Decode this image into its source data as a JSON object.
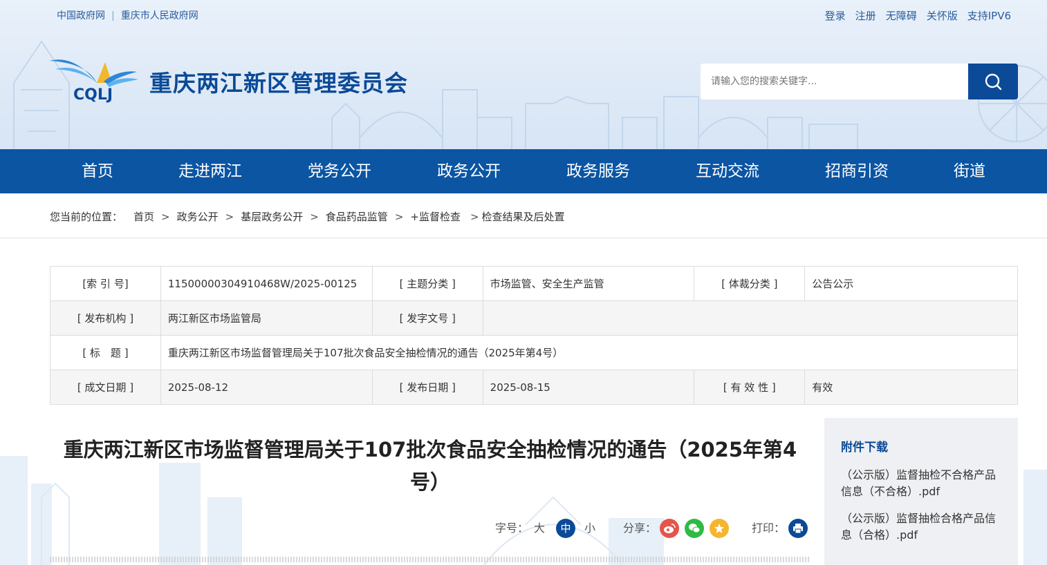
{
  "topbar": {
    "left_links": [
      "中国政府网",
      "重庆市人民政府网"
    ],
    "right_links": [
      "登录",
      "注册",
      "无障碍",
      "关怀版",
      "支持IPV6"
    ]
  },
  "header": {
    "logo_text": "CQLJ",
    "site_title": "重庆两江新区管理委员会",
    "search_placeholder": "请输入您的搜索关键字..."
  },
  "nav": [
    "首页",
    "走进两江",
    "党务公开",
    "政务公开",
    "政务服务",
    "互动交流",
    "招商引资",
    "街道"
  ],
  "breadcrumb": {
    "prefix": "您当前的位置：",
    "items": [
      "首页",
      "政务公开",
      "基层政务公开",
      "食品药品监管",
      "+监督检查",
      "检查结果及后处置"
    ]
  },
  "info": {
    "index_label": "[索 引 号]",
    "index_value": "11500000304910468W/2025-00125",
    "topic_label": "[ 主题分类 ]",
    "topic_value": "市场监管、安全生产监管",
    "genre_label": "[ 体裁分类 ]",
    "genre_value": "公告公示",
    "org_label": "[ 发布机构 ]",
    "org_value": "两江新区市场监管局",
    "docno_label": "[ 发字文号 ]",
    "docno_value": "",
    "title_label": "[ 标　题 ]",
    "title_value": "重庆两江新区市场监督管理局关于107批次食品安全抽检情况的通告（2025年第4号）",
    "written_label": "[ 成文日期 ]",
    "written_value": "2025-08-12",
    "pub_label": "[ 发布日期 ]",
    "pub_value": "2025-08-15",
    "valid_label": "[ 有 效 性 ]",
    "valid_value": "有效"
  },
  "article": {
    "title": "重庆两江新区市场监督管理局关于107批次食品安全抽检情况的通告（2025年第4号）"
  },
  "tools": {
    "font_label": "字号：",
    "font_large": "大",
    "font_medium": "中",
    "font_small": "小",
    "share_label": "分享：",
    "print_label": "打印："
  },
  "attachments": {
    "title": "附件下载",
    "files": [
      "（公示版）监督抽检不合格产品信息（不合格）.pdf",
      "（公示版）监督抽检合格产品信息（合格）.pdf"
    ]
  },
  "colors": {
    "brand": "#0b4a97",
    "nav": "#0b55a3",
    "weibo": "#e6544a",
    "wechat": "#2dbb43",
    "favorite": "#f5b52d"
  }
}
